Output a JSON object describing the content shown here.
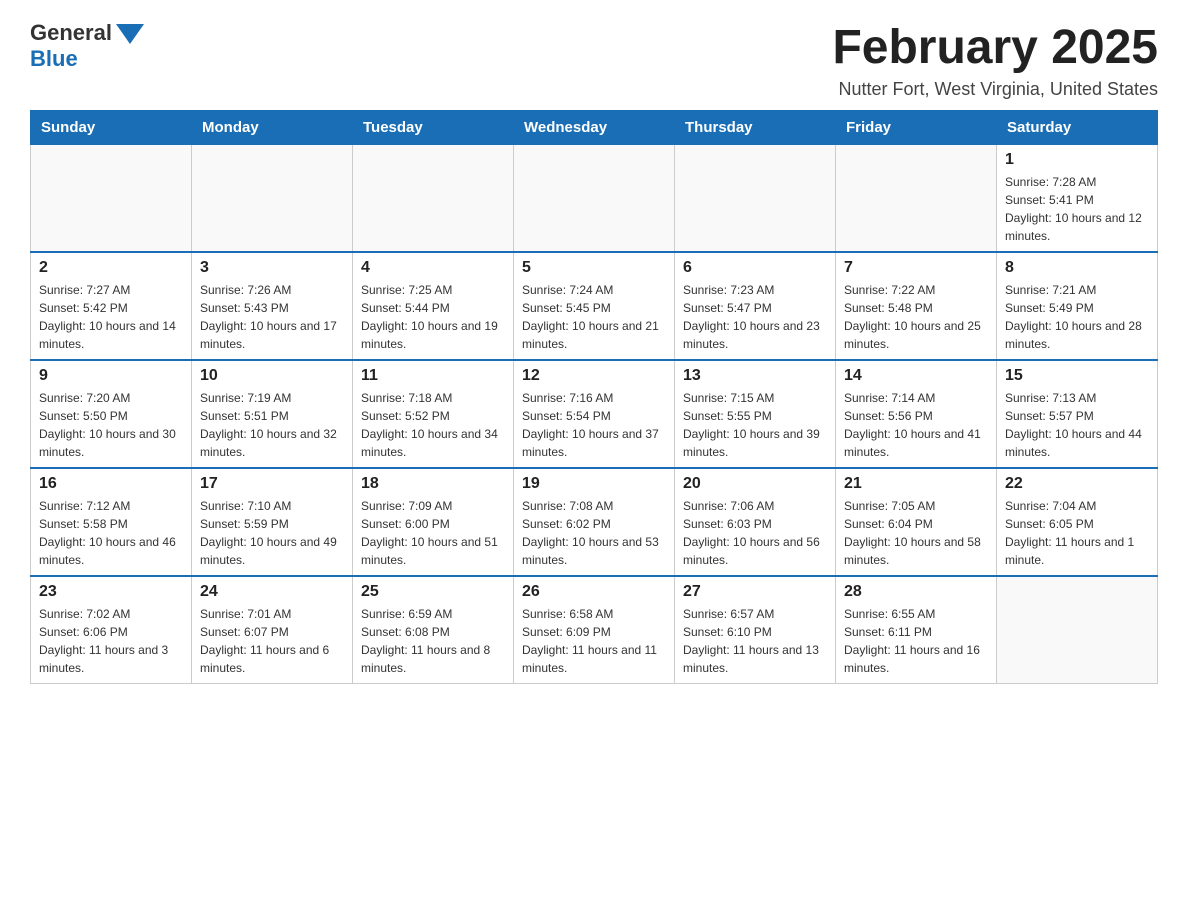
{
  "logo": {
    "general": "General",
    "blue": "Blue"
  },
  "title": "February 2025",
  "subtitle": "Nutter Fort, West Virginia, United States",
  "days_of_week": [
    "Sunday",
    "Monday",
    "Tuesday",
    "Wednesday",
    "Thursday",
    "Friday",
    "Saturday"
  ],
  "weeks": [
    [
      {
        "day": "",
        "info": ""
      },
      {
        "day": "",
        "info": ""
      },
      {
        "day": "",
        "info": ""
      },
      {
        "day": "",
        "info": ""
      },
      {
        "day": "",
        "info": ""
      },
      {
        "day": "",
        "info": ""
      },
      {
        "day": "1",
        "info": "Sunrise: 7:28 AM\nSunset: 5:41 PM\nDaylight: 10 hours and 12 minutes."
      }
    ],
    [
      {
        "day": "2",
        "info": "Sunrise: 7:27 AM\nSunset: 5:42 PM\nDaylight: 10 hours and 14 minutes."
      },
      {
        "day": "3",
        "info": "Sunrise: 7:26 AM\nSunset: 5:43 PM\nDaylight: 10 hours and 17 minutes."
      },
      {
        "day": "4",
        "info": "Sunrise: 7:25 AM\nSunset: 5:44 PM\nDaylight: 10 hours and 19 minutes."
      },
      {
        "day": "5",
        "info": "Sunrise: 7:24 AM\nSunset: 5:45 PM\nDaylight: 10 hours and 21 minutes."
      },
      {
        "day": "6",
        "info": "Sunrise: 7:23 AM\nSunset: 5:47 PM\nDaylight: 10 hours and 23 minutes."
      },
      {
        "day": "7",
        "info": "Sunrise: 7:22 AM\nSunset: 5:48 PM\nDaylight: 10 hours and 25 minutes."
      },
      {
        "day": "8",
        "info": "Sunrise: 7:21 AM\nSunset: 5:49 PM\nDaylight: 10 hours and 28 minutes."
      }
    ],
    [
      {
        "day": "9",
        "info": "Sunrise: 7:20 AM\nSunset: 5:50 PM\nDaylight: 10 hours and 30 minutes."
      },
      {
        "day": "10",
        "info": "Sunrise: 7:19 AM\nSunset: 5:51 PM\nDaylight: 10 hours and 32 minutes."
      },
      {
        "day": "11",
        "info": "Sunrise: 7:18 AM\nSunset: 5:52 PM\nDaylight: 10 hours and 34 minutes."
      },
      {
        "day": "12",
        "info": "Sunrise: 7:16 AM\nSunset: 5:54 PM\nDaylight: 10 hours and 37 minutes."
      },
      {
        "day": "13",
        "info": "Sunrise: 7:15 AM\nSunset: 5:55 PM\nDaylight: 10 hours and 39 minutes."
      },
      {
        "day": "14",
        "info": "Sunrise: 7:14 AM\nSunset: 5:56 PM\nDaylight: 10 hours and 41 minutes."
      },
      {
        "day": "15",
        "info": "Sunrise: 7:13 AM\nSunset: 5:57 PM\nDaylight: 10 hours and 44 minutes."
      }
    ],
    [
      {
        "day": "16",
        "info": "Sunrise: 7:12 AM\nSunset: 5:58 PM\nDaylight: 10 hours and 46 minutes."
      },
      {
        "day": "17",
        "info": "Sunrise: 7:10 AM\nSunset: 5:59 PM\nDaylight: 10 hours and 49 minutes."
      },
      {
        "day": "18",
        "info": "Sunrise: 7:09 AM\nSunset: 6:00 PM\nDaylight: 10 hours and 51 minutes."
      },
      {
        "day": "19",
        "info": "Sunrise: 7:08 AM\nSunset: 6:02 PM\nDaylight: 10 hours and 53 minutes."
      },
      {
        "day": "20",
        "info": "Sunrise: 7:06 AM\nSunset: 6:03 PM\nDaylight: 10 hours and 56 minutes."
      },
      {
        "day": "21",
        "info": "Sunrise: 7:05 AM\nSunset: 6:04 PM\nDaylight: 10 hours and 58 minutes."
      },
      {
        "day": "22",
        "info": "Sunrise: 7:04 AM\nSunset: 6:05 PM\nDaylight: 11 hours and 1 minute."
      }
    ],
    [
      {
        "day": "23",
        "info": "Sunrise: 7:02 AM\nSunset: 6:06 PM\nDaylight: 11 hours and 3 minutes."
      },
      {
        "day": "24",
        "info": "Sunrise: 7:01 AM\nSunset: 6:07 PM\nDaylight: 11 hours and 6 minutes."
      },
      {
        "day": "25",
        "info": "Sunrise: 6:59 AM\nSunset: 6:08 PM\nDaylight: 11 hours and 8 minutes."
      },
      {
        "day": "26",
        "info": "Sunrise: 6:58 AM\nSunset: 6:09 PM\nDaylight: 11 hours and 11 minutes."
      },
      {
        "day": "27",
        "info": "Sunrise: 6:57 AM\nSunset: 6:10 PM\nDaylight: 11 hours and 13 minutes."
      },
      {
        "day": "28",
        "info": "Sunrise: 6:55 AM\nSunset: 6:11 PM\nDaylight: 11 hours and 16 minutes."
      },
      {
        "day": "",
        "info": ""
      }
    ]
  ]
}
